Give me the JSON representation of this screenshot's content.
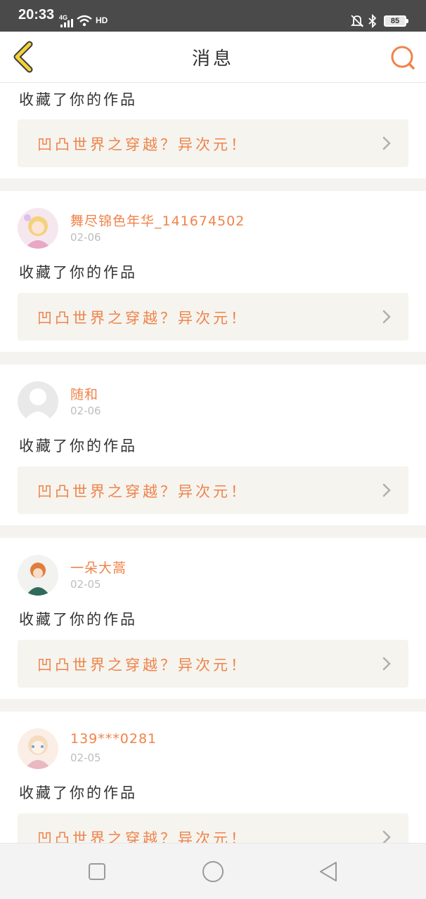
{
  "status_bar": {
    "time": "20:33",
    "network": "4G",
    "hd": "HD",
    "battery": "85"
  },
  "nav": {
    "title": "消息",
    "back_icon": "back-chevron-icon",
    "search_icon": "search-icon"
  },
  "messages": [
    {
      "username": "",
      "date": "",
      "action": "收藏了你的作品",
      "work_title": "凹凸世界之穿越？异次元！"
    },
    {
      "username": "舞尽锦色年华_141674502",
      "date": "02-06",
      "action": "收藏了你的作品",
      "work_title": "凹凸世界之穿越？异次元！"
    },
    {
      "username": "随和",
      "date": "02-06",
      "action": "收藏了你的作品",
      "work_title": "凹凸世界之穿越？异次元！"
    },
    {
      "username": "一朵大蒿",
      "date": "02-05",
      "action": "收藏了你的作品",
      "work_title": "凹凸世界之穿越？异次元！"
    },
    {
      "username": "139***0281",
      "date": "02-05",
      "action": "收藏了你的作品",
      "work_title": "凹凸世界之穿越？异次元！"
    }
  ],
  "colors": {
    "accent": "#f0834a",
    "back_icon": "#f2d13a",
    "work_bg": "#f5f4ef"
  }
}
